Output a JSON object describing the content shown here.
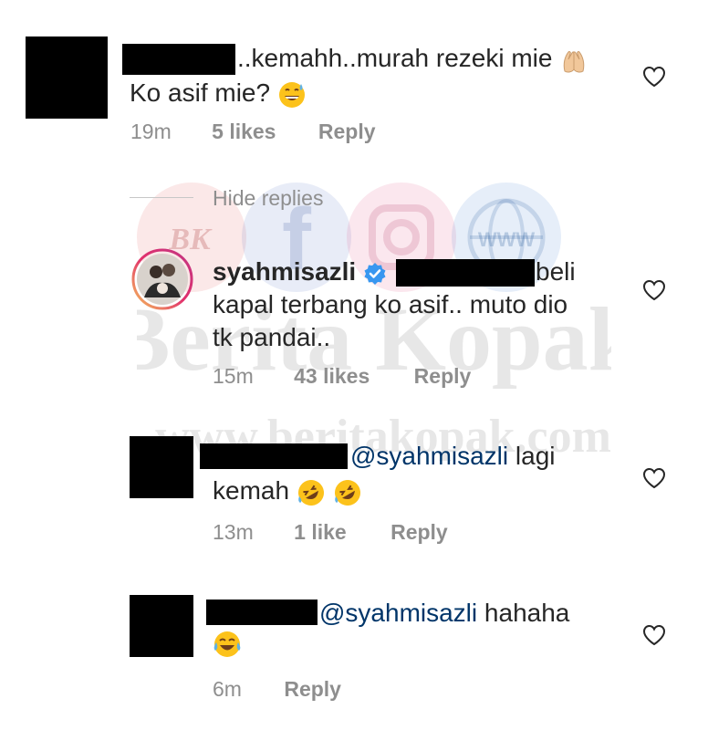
{
  "comments": [
    {
      "line1": "..kemahh..murah rezeki mie",
      "line2": "Ko asif mie?",
      "time": "19m",
      "likes": "5 likes",
      "reply": "Reply"
    }
  ],
  "hide_replies": "Hide replies",
  "replies": [
    {
      "username": "syahmisazli",
      "line1_tail": "beli",
      "line2": "kapal terbang ko asif.. muto dio",
      "line3": "tk pandai..",
      "time": "15m",
      "likes": "43 likes",
      "reply": "Reply"
    },
    {
      "mention": "@syahmisazli",
      "line1_tail": "lagi",
      "line2": "kemah",
      "time": "13m",
      "likes": "1 like",
      "reply": "Reply"
    },
    {
      "mention": "@syahmisazli",
      "line1_tail": "hahaha",
      "time": "6m",
      "reply": "Reply"
    }
  ],
  "watermark": {
    "title": "Berita Kopak",
    "url": "www.beritakopak.com",
    "badge_text": "BK",
    "globe_text": "WWW"
  },
  "colors": {
    "text": "#262626",
    "meta": "#8e8e8e",
    "mention": "#003569",
    "verified": "#3897f0"
  }
}
